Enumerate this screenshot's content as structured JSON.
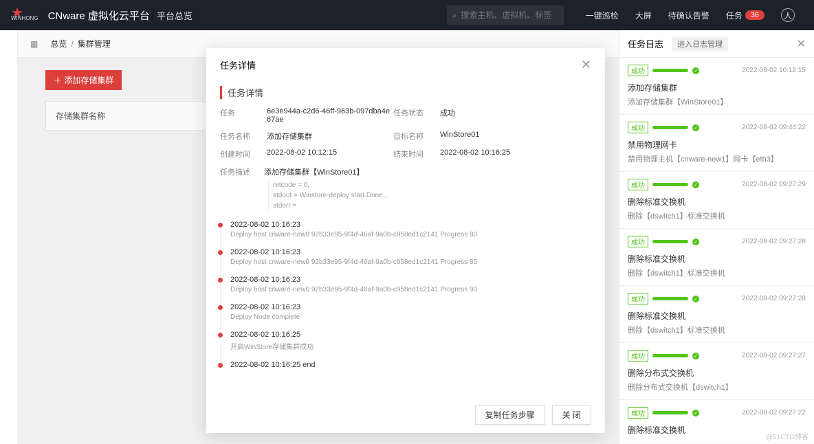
{
  "header": {
    "brand": "CNware 虚拟化云平台",
    "section": "平台总览",
    "search_placeholder": "搜索主机、虚拟机、标签",
    "nav": {
      "inspect": "一键巡检",
      "bigscreen": "大屏",
      "pending": "待确认告警",
      "tasks": "任务",
      "task_count": "36"
    }
  },
  "breadcrumb": {
    "a": "总览",
    "b": "集群管理"
  },
  "page": {
    "add_btn": "添加存储集群",
    "table_header": "存储集群名称"
  },
  "modal": {
    "title": "任务详情",
    "section_title": "任务详情",
    "labels": {
      "task": "任务",
      "status": "任务状态",
      "name": "任务名称",
      "target": "目标名称",
      "created": "创建时间",
      "ended": "结束时间",
      "desc": "任务描述"
    },
    "values": {
      "task_id": "6e3e944a-c2d6-46ff-963b-097dba4e67ae",
      "status": "成功",
      "name": "添加存储集群",
      "target": "WinStore01",
      "created": "2022-08-02 10:12:15",
      "ended": "2022-08-02 10:16:25",
      "desc": "添加存储集群【WinStore01】"
    },
    "stdout": "retcode = 0,\nstdout = Winstore-deploy start.Done.,\nstderr =",
    "logs": [
      {
        "time": "2022-08-02 10:16:23",
        "msg": "Deploy host cnware-new0 92b33e95-9f4d-46af-9a0b-c958ed1c2141 Progress 80"
      },
      {
        "time": "2022-08-02 10:16:23",
        "msg": "Deploy host cnware-new0 92b33e95-9f4d-46af-9a0b-c958ed1c2141 Progress 85"
      },
      {
        "time": "2022-08-02 10:16:23",
        "msg": "Deploy host cnware-new0 92b33e95-9f4d-46af-9a0b-c958ed1c2141 Progress 90"
      },
      {
        "time": "2022-08-02 10:16:23",
        "msg": "Deploy Node complete"
      },
      {
        "time": "2022-08-02 10:16:25",
        "msg": "开启WinStore存储集群成功"
      },
      {
        "time": "2022-08-02 10:16:25 end",
        "msg": ""
      }
    ],
    "footer": {
      "copy": "复制任务步骤",
      "close": "关 闭"
    }
  },
  "task_panel": {
    "title": "任务日志",
    "manage": "进入日志管理",
    "success_label": "成功",
    "items": [
      {
        "time": "2022-08-02 10:12:15",
        "title": "添加存储集群",
        "desc": "添加存储集群【WinStore01】"
      },
      {
        "time": "2022-08-02 09:44:22",
        "title": "禁用物理网卡",
        "desc": "禁用物理主机【cnware-new1】网卡【eth3】"
      },
      {
        "time": "2022-08-02 09:27:29",
        "title": "删除标准交换机",
        "desc": "删除【dswitch1】标准交换机"
      },
      {
        "time": "2022-08-02 09:27:28",
        "title": "删除标准交换机",
        "desc": "删除【dswitch1】标准交换机"
      },
      {
        "time": "2022-08-02 09:27:28",
        "title": "删除标准交换机",
        "desc": "删除【dswitch1】标准交换机"
      },
      {
        "time": "2022-08-02 09:27:27",
        "title": "删除分布式交换机",
        "desc": "删除分布式交换机【dswitch1】"
      },
      {
        "time": "2022-08-02 09:27:22",
        "title": "删除标准交换机",
        "desc": ""
      }
    ]
  },
  "watermark": "@51CTO博客"
}
